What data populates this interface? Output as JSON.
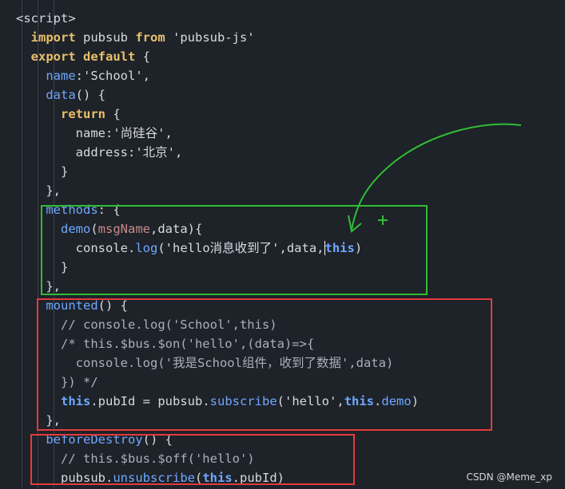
{
  "code_lines": [
    {
      "indent": "",
      "tokens": [
        {
          "c": "tag",
          "t": "<script>"
        }
      ]
    },
    {
      "indent": "  ",
      "tokens": [
        {
          "c": "kw",
          "t": "import"
        },
        {
          "c": "punct",
          "t": " pubsub "
        },
        {
          "c": "kw",
          "t": "from"
        },
        {
          "c": "str",
          "t": " 'pubsub-js'"
        }
      ]
    },
    {
      "indent": "  ",
      "tokens": [
        {
          "c": "kw",
          "t": "export default"
        },
        {
          "c": "punct",
          "t": " {"
        }
      ]
    },
    {
      "indent": "    ",
      "tokens": [
        {
          "c": "fn",
          "t": "name"
        },
        {
          "c": "punct",
          "t": ":"
        },
        {
          "c": "str",
          "t": "'School'"
        },
        {
          "c": "punct",
          "t": ","
        }
      ]
    },
    {
      "indent": "    ",
      "tokens": [
        {
          "c": "fn",
          "t": "data"
        },
        {
          "c": "punct",
          "t": "() {"
        }
      ]
    },
    {
      "indent": "      ",
      "tokens": [
        {
          "c": "kw",
          "t": "return"
        },
        {
          "c": "punct",
          "t": " {"
        }
      ]
    },
    {
      "indent": "        ",
      "tokens": [
        {
          "c": "prop",
          "t": "name"
        },
        {
          "c": "punct",
          "t": ":"
        },
        {
          "c": "str",
          "t": "'尚硅谷'"
        },
        {
          "c": "punct",
          "t": ","
        }
      ]
    },
    {
      "indent": "        ",
      "tokens": [
        {
          "c": "prop",
          "t": "address"
        },
        {
          "c": "punct",
          "t": ":"
        },
        {
          "c": "str",
          "t": "'北京'"
        },
        {
          "c": "punct",
          "t": ","
        }
      ]
    },
    {
      "indent": "      ",
      "tokens": [
        {
          "c": "punct",
          "t": "}"
        }
      ]
    },
    {
      "indent": "    ",
      "tokens": [
        {
          "c": "punct",
          "t": "},"
        }
      ]
    },
    {
      "indent": "    ",
      "tokens": [
        {
          "c": "fn",
          "t": "methods"
        },
        {
          "c": "punct",
          "t": ": {"
        }
      ]
    },
    {
      "indent": "      ",
      "tokens": [
        {
          "c": "fn",
          "t": "demo"
        },
        {
          "c": "punct",
          "t": "("
        },
        {
          "c": "param",
          "t": "msgName"
        },
        {
          "c": "punct",
          "t": ","
        },
        {
          "c": "prop",
          "t": "data"
        },
        {
          "c": "punct",
          "t": "){"
        }
      ]
    },
    {
      "indent": "        ",
      "tokens": [
        {
          "c": "prop",
          "t": "console"
        },
        {
          "c": "punct",
          "t": "."
        },
        {
          "c": "fn",
          "t": "log"
        },
        {
          "c": "punct",
          "t": "("
        },
        {
          "c": "str",
          "t": "'hello消息收到了'"
        },
        {
          "c": "punct",
          "t": ",data,"
        },
        {
          "c": "thiskw cursor-thing",
          "t": "this"
        },
        {
          "c": "punct",
          "t": ")"
        }
      ]
    },
    {
      "indent": "      ",
      "tokens": [
        {
          "c": "punct",
          "t": "}"
        }
      ]
    },
    {
      "indent": "    ",
      "tokens": [
        {
          "c": "punct",
          "t": "},"
        }
      ]
    },
    {
      "indent": "    ",
      "tokens": [
        {
          "c": "fn",
          "t": "mounted"
        },
        {
          "c": "punct",
          "t": "() {"
        }
      ]
    },
    {
      "indent": "      ",
      "tokens": [
        {
          "c": "cmt",
          "t": "// console.log('School',this)"
        }
      ]
    },
    {
      "indent": "      ",
      "tokens": [
        {
          "c": "cmt",
          "t": "/* this.$bus.$on('hello',(data)=>{"
        }
      ]
    },
    {
      "indent": "        ",
      "tokens": [
        {
          "c": "cmt",
          "t": "console.log('我是School组件，收到了数据',data)"
        }
      ]
    },
    {
      "indent": "      ",
      "tokens": [
        {
          "c": "cmt",
          "t": "}) */"
        }
      ]
    },
    {
      "indent": "      ",
      "tokens": [
        {
          "c": "thiskw",
          "t": "this"
        },
        {
          "c": "punct",
          "t": "."
        },
        {
          "c": "prop",
          "t": "pubId"
        },
        {
          "c": "punct",
          "t": " = pubsub."
        },
        {
          "c": "fn",
          "t": "subscribe"
        },
        {
          "c": "punct",
          "t": "("
        },
        {
          "c": "str",
          "t": "'hello'"
        },
        {
          "c": "punct",
          "t": ","
        },
        {
          "c": "thiskw",
          "t": "this"
        },
        {
          "c": "punct",
          "t": "."
        },
        {
          "c": "fn",
          "t": "demo"
        },
        {
          "c": "punct",
          "t": ")"
        }
      ]
    },
    {
      "indent": "    ",
      "tokens": [
        {
          "c": "punct",
          "t": "},"
        }
      ]
    },
    {
      "indent": "    ",
      "tokens": [
        {
          "c": "fn",
          "t": "beforeDestroy"
        },
        {
          "c": "punct",
          "t": "() {"
        }
      ]
    },
    {
      "indent": "      ",
      "tokens": [
        {
          "c": "cmt",
          "t": "// this.$bus.$off('hello')"
        }
      ]
    },
    {
      "indent": "      ",
      "tokens": [
        {
          "c": "prop",
          "t": "pubsub."
        },
        {
          "c": "fn",
          "t": "unsubscribe"
        },
        {
          "c": "punct",
          "t": "("
        },
        {
          "c": "thiskw",
          "t": "this"
        },
        {
          "c": "punct",
          "t": "."
        },
        {
          "c": "prop",
          "t": "pubId"
        },
        {
          "c": "punct",
          "t": ")"
        }
      ]
    }
  ],
  "annotations": {
    "green_box_color": "#2fbe34",
    "red_box_color": "#e23c3c",
    "arrow_color": "#2fbe34"
  },
  "watermark": "CSDN @Meme_xp"
}
